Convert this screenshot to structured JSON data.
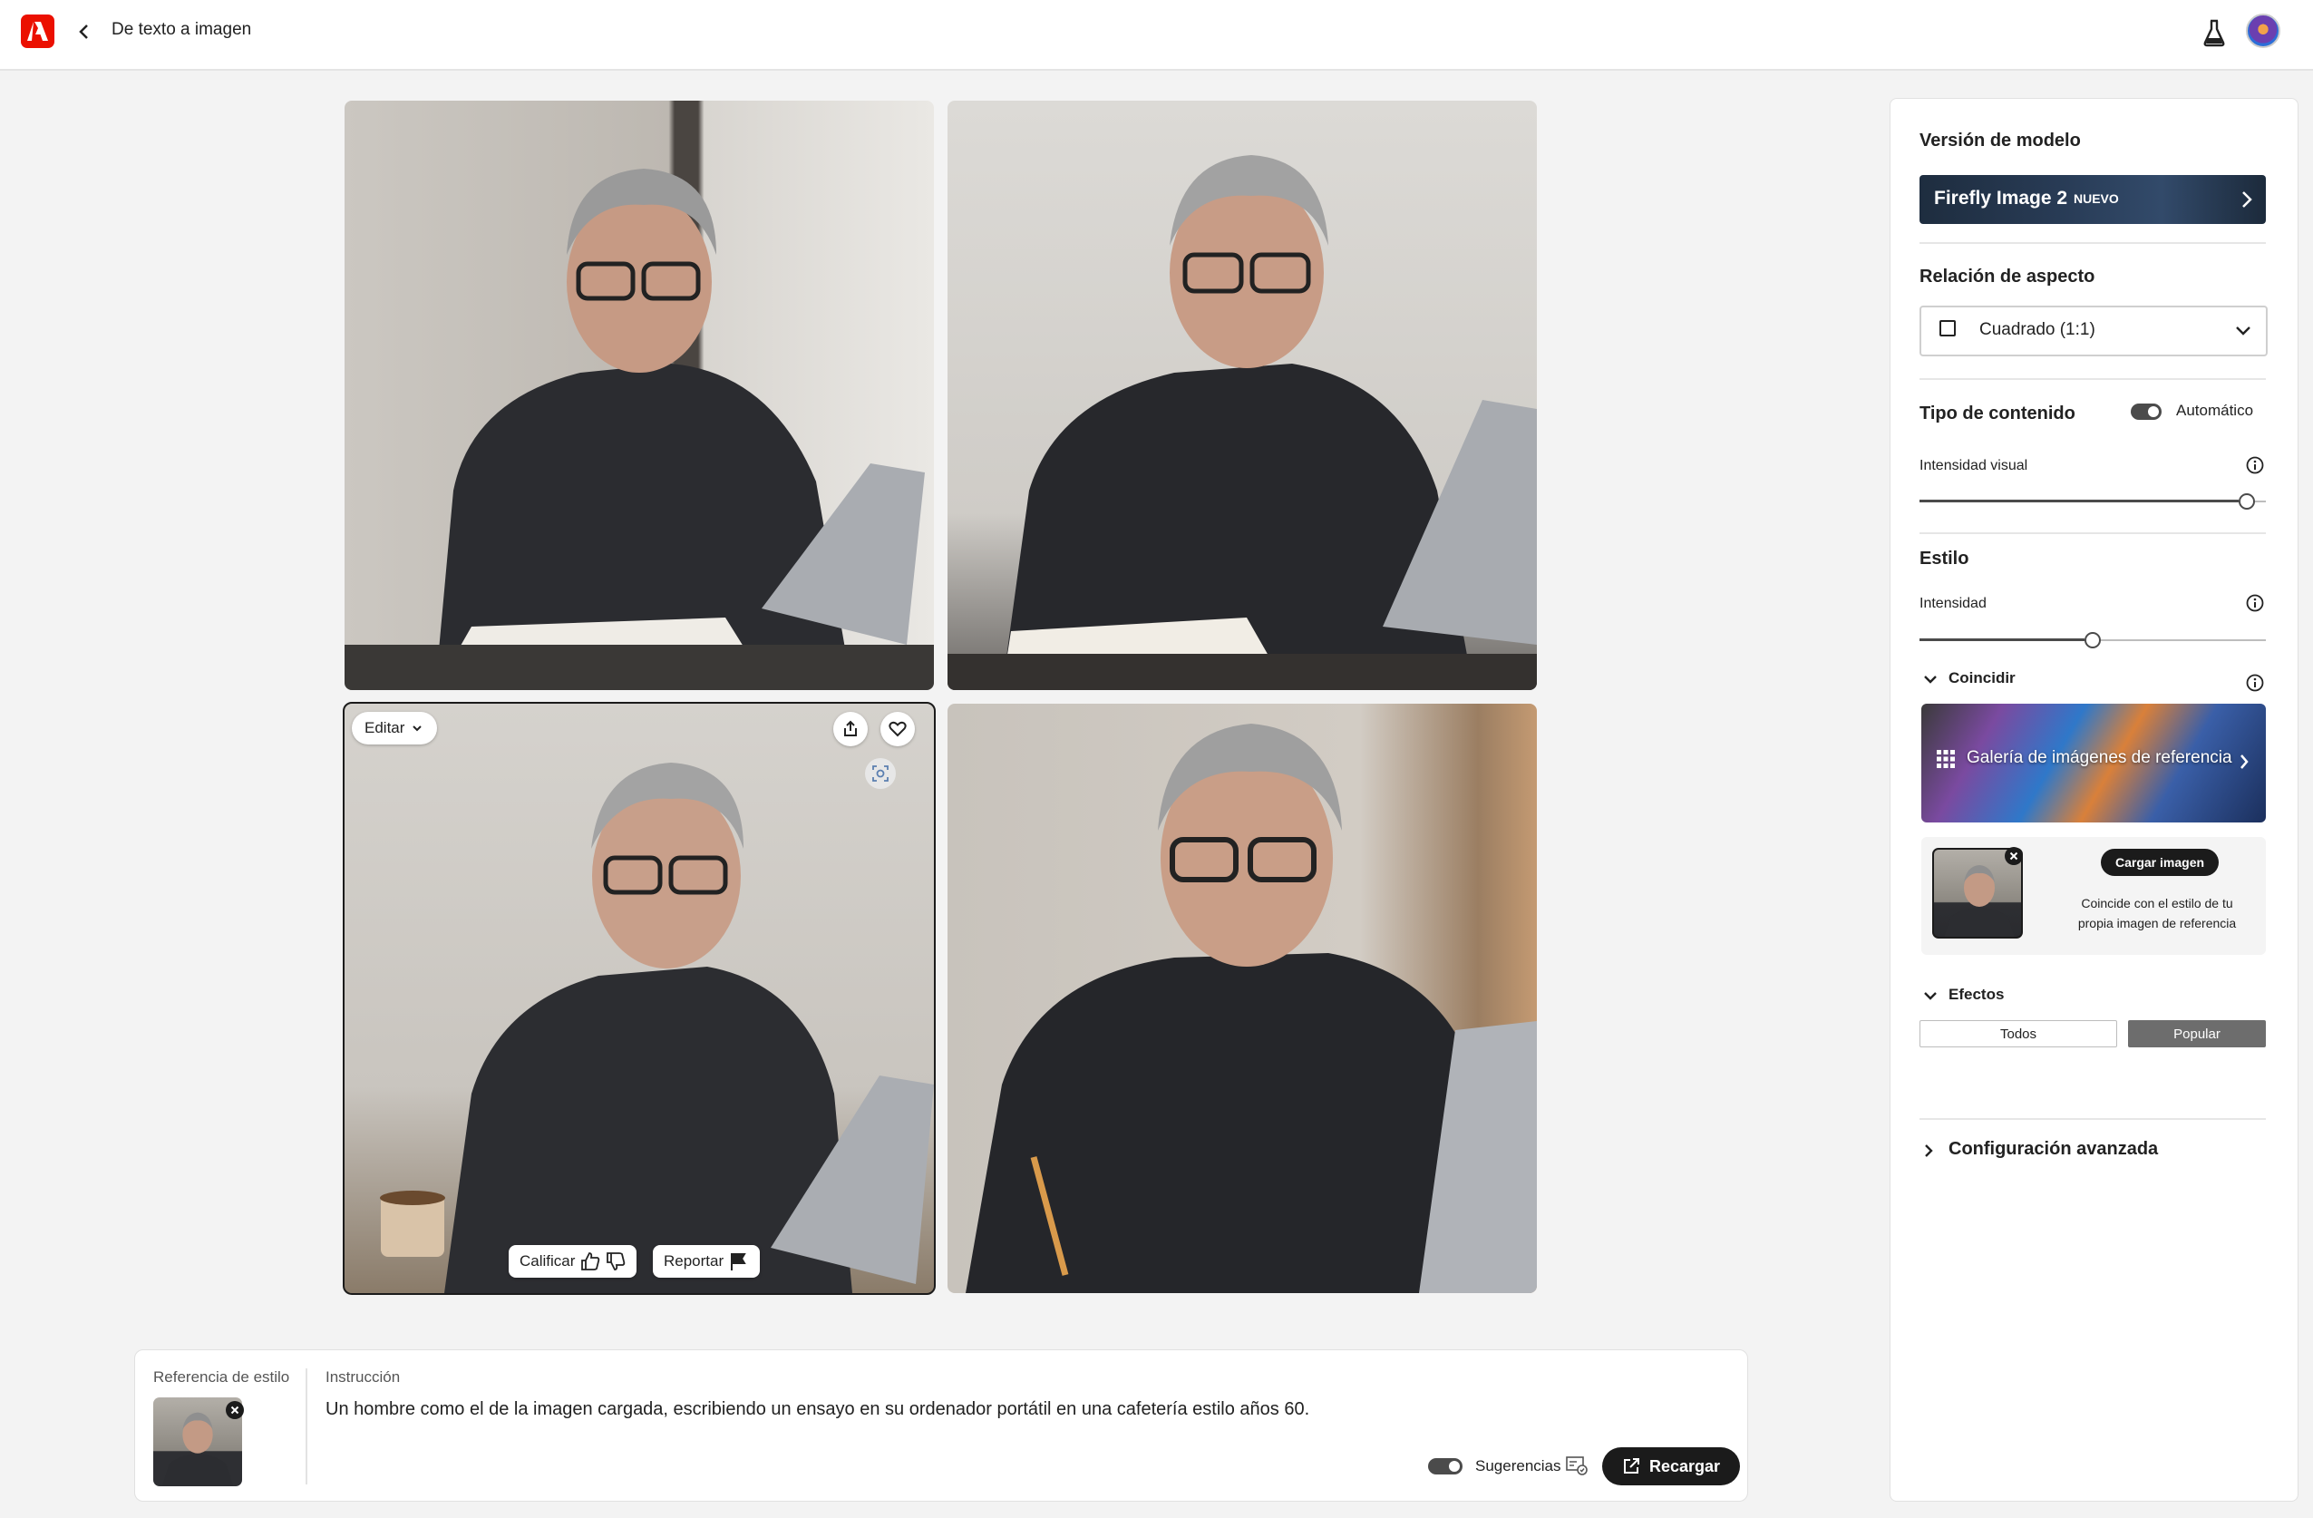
{
  "header": {
    "title": "De texto a imagen"
  },
  "image_toolbar": {
    "edit_label": "Editar",
    "rate_label": "Calificar",
    "report_label": "Reportar"
  },
  "panel": {
    "model_heading": "Versión de modelo",
    "model_name": "Firefly Image 2",
    "model_badge": "NUEVO",
    "aspect_heading": "Relación de aspecto",
    "aspect_value": "Cuadrado (1:1)",
    "content_type_heading": "Tipo de contenido",
    "content_type_toggle_label": "Automático",
    "visual_intensity_label": "Intensidad visual",
    "visual_intensity_value": 1.0,
    "style_heading": "Estilo",
    "intensity_label": "Intensidad",
    "intensity_value": 0.5,
    "match_heading": "Coincidir",
    "gallery_label": "Galería de imágenes de referencia",
    "upload_label": "Cargar imagen",
    "upload_desc_line1": "Coincide con el estilo de tu",
    "upload_desc_line2": "propia imagen de referencia",
    "effects_heading": "Efectos",
    "effects_tabs": [
      "Todos",
      "Popular"
    ],
    "effects_selected": "Popular",
    "advanced_label": "Configuración avanzada"
  },
  "prompt_bar": {
    "style_ref_label": "Referencia de estilo",
    "instruction_label": "Instrucción",
    "instruction_text": "Un hombre como el de la imagen cargada, escribiendo un ensayo en su ordenador portátil en una cafetería estilo años 60.",
    "suggestions_label": "Sugerencias",
    "reload_label": "Recargar"
  },
  "colors": {
    "adobe_red": "#eb1000",
    "dark": "#1b1b1b"
  }
}
